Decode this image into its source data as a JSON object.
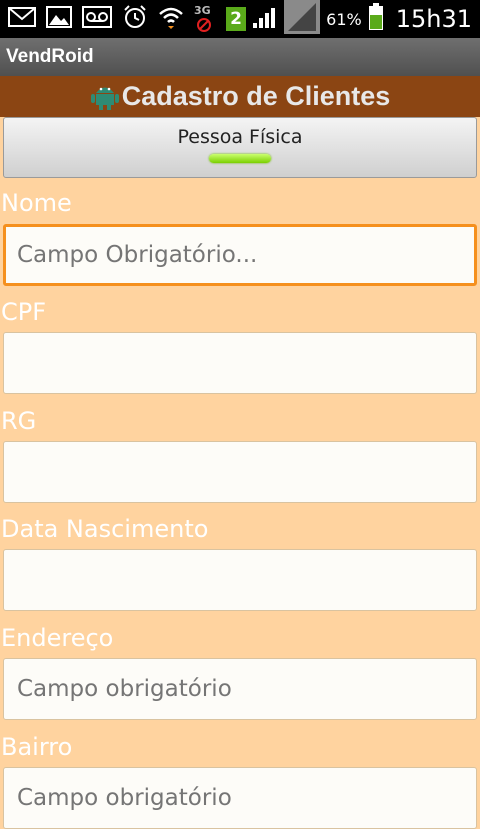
{
  "status_bar": {
    "icons_left": [
      "mail-icon",
      "image-icon",
      "voicemail-icon",
      "alarm-icon",
      "wifi-icon",
      "3g-no-data-icon",
      "notification-count-badge"
    ],
    "notification_count": "2",
    "network_type": "3G",
    "battery_percent": "61%",
    "battery_level": 0.61,
    "time": "15h31"
  },
  "app": {
    "title": "VendRoid"
  },
  "header": {
    "title": "Cadastro de Clientes",
    "icon": "android-robot-icon"
  },
  "person_type_toggle": {
    "label": "Pessoa Física",
    "on": true,
    "indicator_color": "#8be000"
  },
  "fields": [
    {
      "label": "Nome",
      "value": "",
      "placeholder": "Campo Obrigatório...",
      "focused": true
    },
    {
      "label": "CPF",
      "value": "",
      "placeholder": ""
    },
    {
      "label": "RG",
      "value": "",
      "placeholder": ""
    },
    {
      "label": "Data Nascimento",
      "value": "",
      "placeholder": ""
    },
    {
      "label": "Endereço",
      "value": "",
      "placeholder": "Campo obrigatório"
    },
    {
      "label": "Bairro",
      "value": "",
      "placeholder": "Campo obrigatório"
    }
  ],
  "colors": {
    "background": "#ffd39f",
    "header_bg": "#8b4513",
    "title_bar": "#5a5a5a",
    "focus_border": "#f5901e",
    "label_text": "#ffffff"
  }
}
